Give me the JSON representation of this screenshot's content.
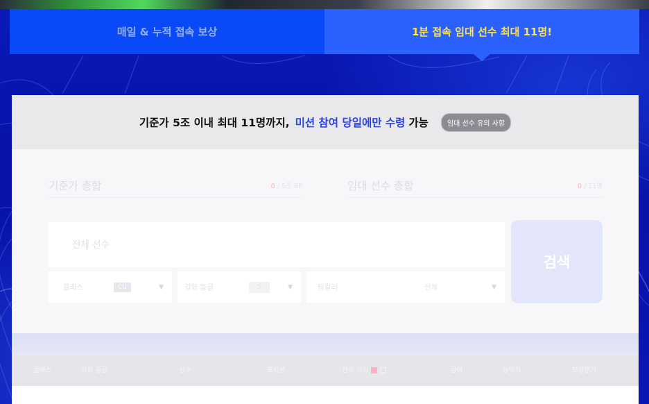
{
  "tabs": [
    {
      "label": "매일 & 누적 접속 보상",
      "active": false
    },
    {
      "label": "1분 접속 임대 선수 최대 11명!",
      "active": true
    }
  ],
  "notice": {
    "main": "기준가 5조 이내 최대 11명까지,",
    "highlight": "미션 참여 당일에만 수령",
    "tail": "가능",
    "pill": "임대 선수 유의 사항"
  },
  "summary": {
    "left": {
      "label": "기준가 총합",
      "current": "0",
      "max": " / 5조 BP"
    },
    "right": {
      "label": "임대 선수 총합",
      "current": "0",
      "max": " / 11명"
    }
  },
  "search": {
    "placeholder": "전체 선수",
    "button": "검색"
  },
  "filters": {
    "class": {
      "label": "클래스",
      "value": "CU"
    },
    "grade": {
      "label": "강화 등급",
      "value": "5"
    },
    "team": {
      "label": "팀컬러",
      "value": "전체"
    }
  },
  "table": {
    "headers": [
      "클래스",
      "강화 등급",
      "선수",
      "포지션",
      "선수 가치",
      "급여",
      "능력치",
      "보상받기"
    ]
  },
  "colors": {
    "tab_active": "#2b62ff",
    "tab_inactive": "#0a49f7",
    "highlight_text": "#2d43e6",
    "tab_active_text": "#ffe14a"
  }
}
